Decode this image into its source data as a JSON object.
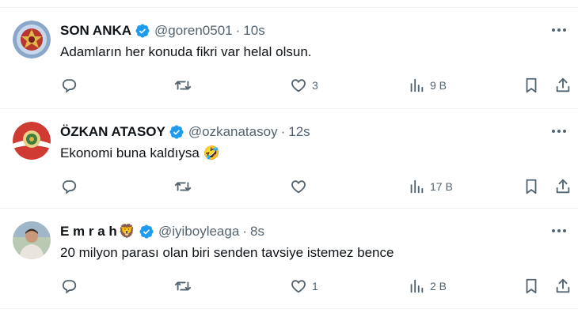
{
  "colors": {
    "text": "#0f1419",
    "secondary": "#536471",
    "verified": "#1d9bf0",
    "divider": "#eff3f4"
  },
  "tweets": [
    {
      "name": "SON ANKA",
      "handle": "@goren0501",
      "separator": "·",
      "time": "10s",
      "name_emoji": "",
      "text": "Adamların her konuda fikri var helal olsun.",
      "likes": "3",
      "views": "9 B",
      "avatar_icon": "red-seal-avatar"
    },
    {
      "name": "ÖZKAN ATASOY",
      "handle": "@ozkanatasoy",
      "separator": "·",
      "time": "12s",
      "name_emoji": "",
      "text": "Ekonomi buna kaldıysa 🤣",
      "likes": "",
      "views": "17 B",
      "avatar_icon": "red-emblem-avatar"
    },
    {
      "name": "E m r a h",
      "handle": "@iyiboyleaga",
      "separator": "·",
      "time": "8s",
      "name_emoji": "🦁",
      "text": "20 milyon parası olan biri senden tavsiye istemez bence",
      "likes": "1",
      "views": "2 B",
      "avatar_icon": "person-photo-avatar"
    }
  ],
  "icons": [
    "verified-badge-icon",
    "more-icon",
    "reply-icon",
    "retweet-icon",
    "like-icon",
    "views-icon",
    "bookmark-icon",
    "share-icon"
  ]
}
